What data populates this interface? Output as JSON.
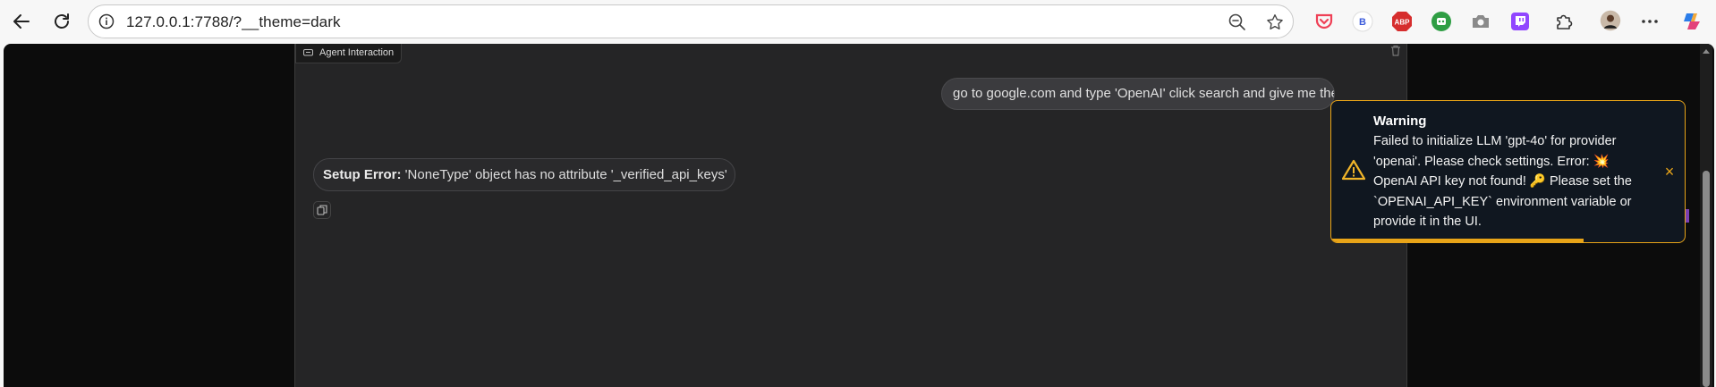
{
  "browser": {
    "url": "127.0.0.1:7788/?__theme=dark"
  },
  "panel": {
    "label": "Agent Interaction"
  },
  "chat": {
    "user_message": "go to google.com and type 'OpenAI' click search and give me the first url",
    "error_label": "Setup Error:",
    "error_text": " 'NoneType' object has no attribute '_verified_api_keys'"
  },
  "toast": {
    "title": "Warning",
    "message": "Failed to initialize LLM 'gpt-4o' for provider 'openai'. Please check settings. Error: 💥 OpenAI API key not found! 🔑 Please set the `OPENAI_API_KEY` environment variable or provide it in the UI.",
    "close_label": "×",
    "progress": 0.715,
    "accent_color": "#e8a418"
  },
  "extensions": [
    "pocket-icon",
    "profile-b-icon",
    "adblock-plus-icon",
    "robot-extension-icon",
    "camera-icon",
    "twitch-icon",
    "puzzle-icon",
    "avatar",
    "more-icon",
    "copilot-icon"
  ]
}
